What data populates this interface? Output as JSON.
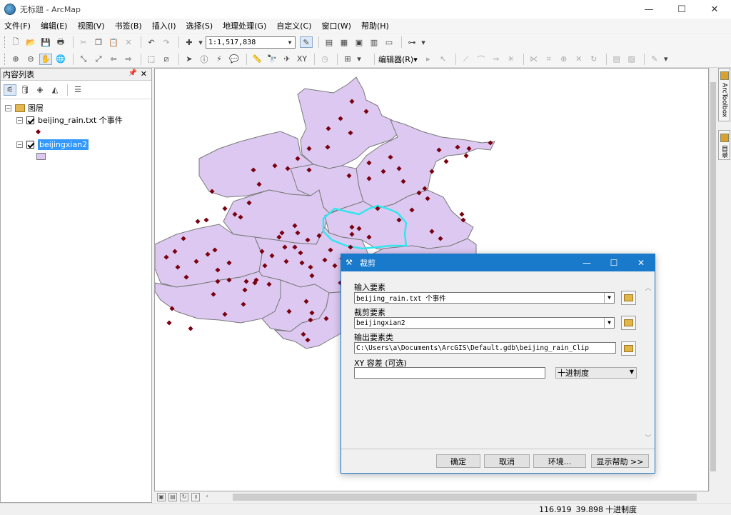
{
  "window": {
    "title": "无标题 - ArcMap",
    "min": "—",
    "max": "☐",
    "close": "✕"
  },
  "menu": [
    "文件(F)",
    "编辑(E)",
    "视图(V)",
    "书签(B)",
    "插入(I)",
    "选择(S)",
    "地理处理(G)",
    "自定义(C)",
    "窗口(W)",
    "帮助(H)"
  ],
  "toolbar": {
    "scale": "1:1,517,838",
    "editor_label": "编辑器(R)▾"
  },
  "toc": {
    "title": "内容列表",
    "pin": "ꟷ",
    "close": "✕",
    "root": "图层",
    "layers": [
      {
        "name": "beijing_rain.txt 个事件",
        "checked": true
      },
      {
        "name": "beijingxian2",
        "checked": true
      }
    ]
  },
  "right_dock": {
    "tabs": [
      "ArcToolbox",
      "目录"
    ]
  },
  "dialog": {
    "title": "裁剪",
    "input_label": "输入要素",
    "input_value": "beijing_rain.txt 个事件",
    "clip_label": "裁剪要素",
    "clip_value": "beijingxian2",
    "output_label": "输出要素类",
    "output_value": "C:\\Users\\a\\Documents\\ArcGIS\\Default.gdb\\beijing_rain_Clip",
    "xy_label": "XY 容差 (可选)",
    "xy_value": "",
    "unit_value": "十进制度",
    "buttons": {
      "ok": "确定",
      "cancel": "取消",
      "env": "环境...",
      "help": "显示帮助 >>"
    }
  },
  "status": {
    "x": "116.919",
    "y": "39.898",
    "units": "十进制度"
  },
  "colors": {
    "polygon_fill": "#dcc8f0",
    "polygon_stroke": "#7a7a7a",
    "selection": "#33e6ee",
    "point": "#7a0010",
    "title_blue": "#1979ca"
  }
}
